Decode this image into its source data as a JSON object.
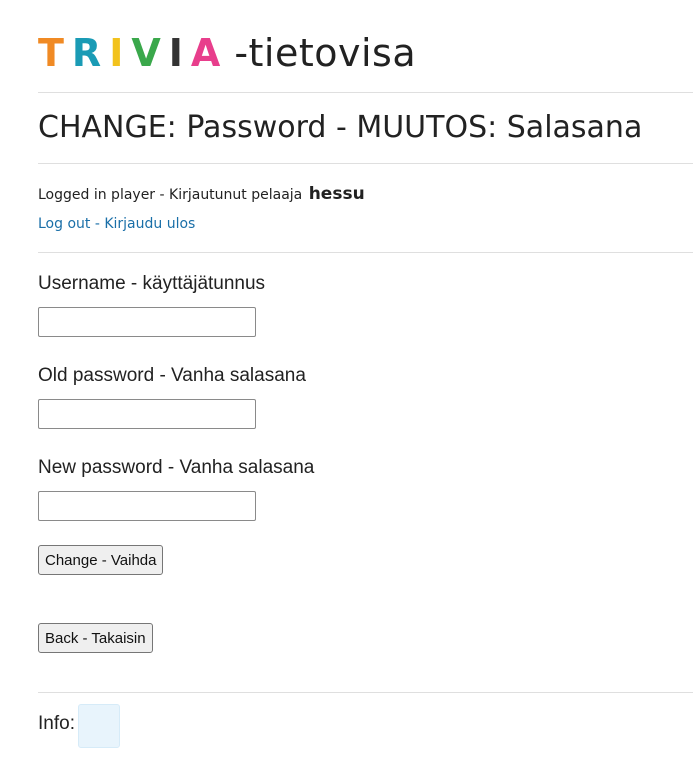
{
  "logo": {
    "letters": [
      {
        "char": "T",
        "color": "#f08a24"
      },
      {
        "char": "R",
        "color": "#1a9bb5"
      },
      {
        "char": "I",
        "color": "#f2c21c"
      },
      {
        "char": "V",
        "color": "#3aa84b"
      },
      {
        "char": "I",
        "color": "#333333"
      },
      {
        "char": "A",
        "color": "#e83e8c"
      }
    ],
    "suffix": "-tietovisa"
  },
  "page_title": "CHANGE: Password - MUUTOS: Salasana",
  "session": {
    "logged_in_text": "Logged in player - Kirjautunut pelaaja",
    "username": "hessu",
    "logout_label": "Log out - Kirjaudu ulos"
  },
  "form": {
    "username_label": "Username - käyttäjätunnus",
    "username_value": "",
    "old_password_label": "Old password - Vanha salasana",
    "old_password_value": "",
    "new_password_label": "New password - Vanha salasana",
    "new_password_value": "",
    "change_button": "Change - Vaihda"
  },
  "back_button": "Back - Takaisin",
  "info": {
    "label": "Info:",
    "content": ""
  },
  "colors": {
    "link": "#1a6fa8",
    "divider": "#dfdfdf",
    "info_box_bg": "#e8f4fc"
  }
}
